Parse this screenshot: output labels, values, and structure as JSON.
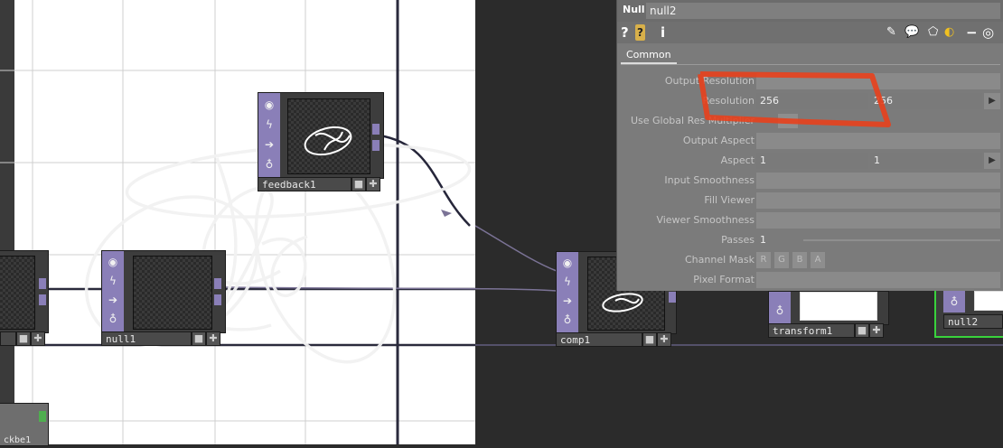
{
  "panel": {
    "type_label": "Null",
    "node_name": "null2",
    "toolbar_icons": [
      "help-icon",
      "info-lock-icon",
      "info-icon",
      "edit-icon",
      "comment-icon",
      "clone-icon",
      "python-icon",
      "minimize-icon",
      "target-icon"
    ],
    "tab": "Common",
    "params": [
      {
        "label": "Output Resolution",
        "value": "",
        "kind": "menu"
      },
      {
        "label": "Resolution",
        "value1": "256",
        "value2": "256",
        "kind": "pair"
      },
      {
        "label": "Use Global Res Multiplier",
        "kind": "toggle"
      },
      {
        "label": "Output Aspect",
        "value": "",
        "kind": "menu"
      },
      {
        "label": "Aspect",
        "value1": "1",
        "value2": "1",
        "kind": "pair"
      },
      {
        "label": "Input Smoothness",
        "value": "",
        "kind": "menu"
      },
      {
        "label": "Fill Viewer",
        "value": "",
        "kind": "menu"
      },
      {
        "label": "Viewer Smoothness",
        "value": "",
        "kind": "menu"
      },
      {
        "label": "Passes",
        "value": "1",
        "kind": "slider"
      },
      {
        "label": "Channel Mask",
        "kind": "mask",
        "channels": [
          "R",
          "G",
          "B",
          "A"
        ]
      },
      {
        "label": "Pixel Format",
        "value": "",
        "kind": "menu"
      }
    ]
  },
  "nodes": {
    "feedback1": "feedback1",
    "null1": "null1",
    "comp1": "comp1",
    "transform1": "transform1",
    "null2": "null2",
    "offscreen_partial": "",
    "bottom_partial": "ckbe1"
  },
  "node_icons": [
    "viewer-icon",
    "bypass-icon",
    "arrow-icon",
    "lock-icon"
  ],
  "colors": {
    "operator_purple": "#8a7fb8",
    "annotation_red": "#e8401c",
    "selected_green": "#39d23c",
    "viewer_white": "#ffffff",
    "panel_gray": "#7b7b7b"
  }
}
